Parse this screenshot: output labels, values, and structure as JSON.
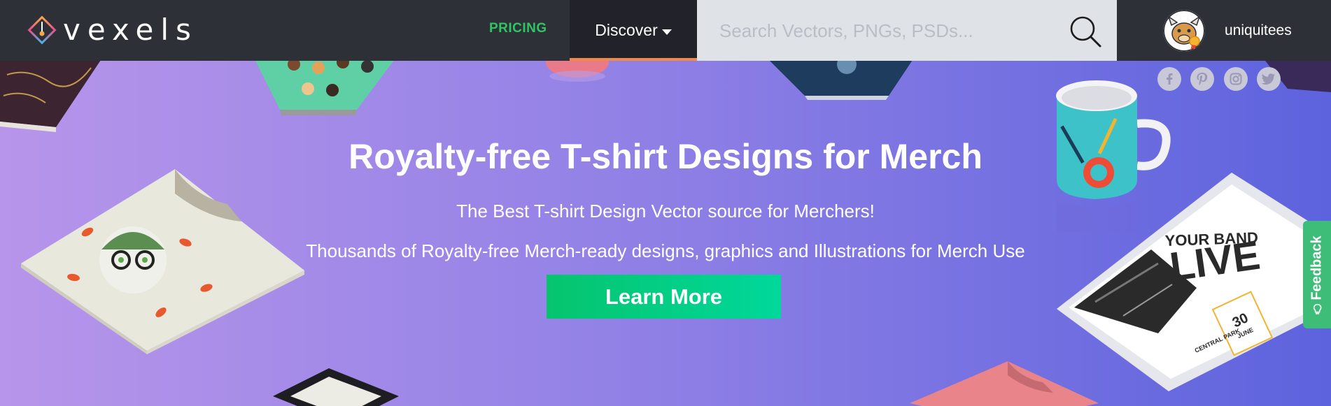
{
  "brand": {
    "name": "vexels"
  },
  "nav": {
    "pricing_label": "PRICING",
    "discover_label": "Discover"
  },
  "search": {
    "placeholder": "Search Vectors, PNGs, PSDs..."
  },
  "user": {
    "username": "uniquitees"
  },
  "social": {
    "items": [
      "facebook",
      "pinterest",
      "instagram",
      "twitter"
    ]
  },
  "hero": {
    "title": "Royalty-free T-shirt Designs for Merch",
    "subtitle_1": "The Best T-shirt Design Vector source for Merchers!",
    "subtitle_2": "Thousands of Royalty-free Merch-ready designs, graphics and Illustrations for Merch Use",
    "cta_label": "Learn More"
  },
  "poster": {
    "line1": "YOUR BAND",
    "line2": "LIVE",
    "date_day": "30",
    "date_month": "JUNE",
    "venue": "CENTRAL PARK"
  },
  "feedback": {
    "label": "Feedback"
  },
  "colors": {
    "topbar": "#2e3038",
    "pricing": "#2ec562",
    "cta": "#06c46e",
    "feedback": "#3dbd78",
    "hero_start": "#b795ea",
    "hero_end": "#5d63dd"
  }
}
